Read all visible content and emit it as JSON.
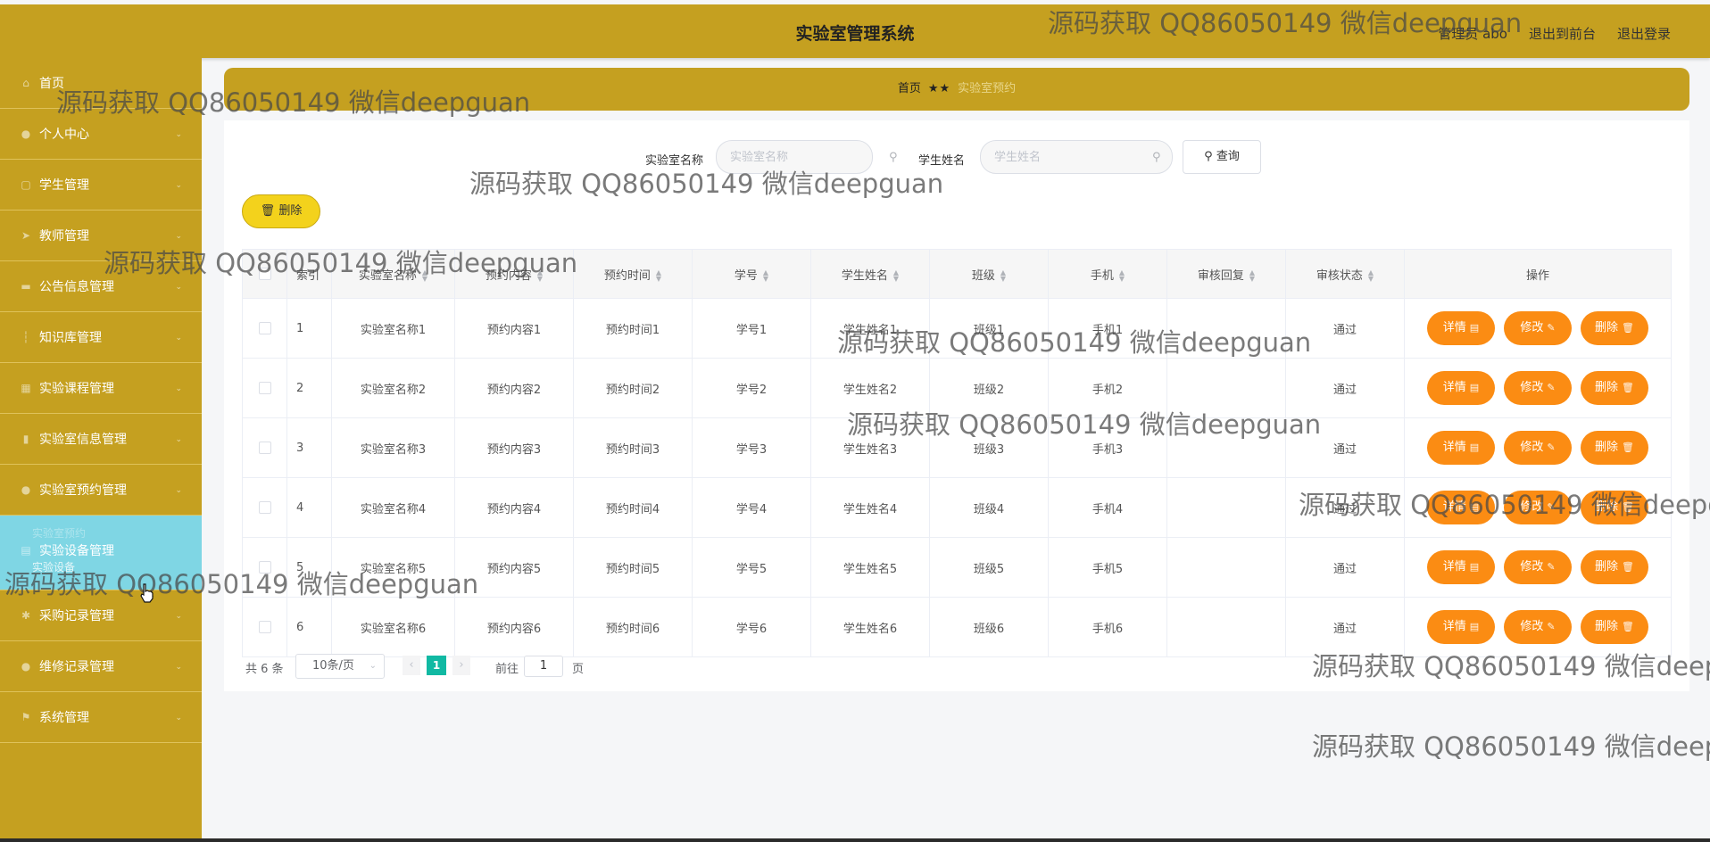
{
  "header": {
    "title": "实验室管理系统",
    "user": "管理员 abo",
    "to_front": "退出到前台",
    "logout": "退出登录"
  },
  "sidebar": {
    "items": [
      {
        "label": "首页",
        "icon": "home-icon"
      },
      {
        "label": "个人中心",
        "icon": "user-icon"
      },
      {
        "label": "学生管理",
        "icon": "list-icon"
      },
      {
        "label": "教师管理",
        "icon": "send-icon"
      },
      {
        "label": "公告信息管理",
        "icon": "folder-icon"
      },
      {
        "label": "知识库管理",
        "icon": "pin-icon"
      },
      {
        "label": "实验课程管理",
        "icon": "grid-icon"
      },
      {
        "label": "实验室信息管理",
        "icon": "chart-icon"
      },
      {
        "label": "实验室预约管理",
        "icon": "user-icon"
      },
      {
        "label": "实验设备管理",
        "icon": "briefcase-icon",
        "sub_above": "实验室预约",
        "sub_below": "实验设备"
      },
      {
        "label": "采购记录管理",
        "icon": "gear-icon"
      },
      {
        "label": "维修记录管理",
        "icon": "user-icon"
      },
      {
        "label": "系统管理",
        "icon": "flag-icon"
      }
    ]
  },
  "breadcrumb": {
    "home": "首页",
    "sep": "★★",
    "current": "实验室预约"
  },
  "search": {
    "lab_label": "实验室名称",
    "lab_placeholder": "实验室名称",
    "student_label": "学生姓名",
    "student_placeholder": "学生姓名",
    "query": "查询"
  },
  "toolbar": {
    "delete": "删除"
  },
  "table": {
    "headers": [
      "索引",
      "实验室名称",
      "预约内容",
      "预约时间",
      "学号",
      "学生姓名",
      "班级",
      "手机",
      "审核回复",
      "审核状态",
      "操作"
    ],
    "rows": [
      [
        "1",
        "实验室名称1",
        "预约内容1",
        "预约时间1",
        "学号1",
        "学生姓名1",
        "班级1",
        "手机1",
        "",
        "通过"
      ],
      [
        "2",
        "实验室名称2",
        "预约内容2",
        "预约时间2",
        "学号2",
        "学生姓名2",
        "班级2",
        "手机2",
        "",
        "通过"
      ],
      [
        "3",
        "实验室名称3",
        "预约内容3",
        "预约时间3",
        "学号3",
        "学生姓名3",
        "班级3",
        "手机3",
        "",
        "通过"
      ],
      [
        "4",
        "实验室名称4",
        "预约内容4",
        "预约时间4",
        "学号4",
        "学生姓名4",
        "班级4",
        "手机4",
        "",
        "通过"
      ],
      [
        "5",
        "实验室名称5",
        "预约内容5",
        "预约时间5",
        "学号5",
        "学生姓名5",
        "班级5",
        "手机5",
        "",
        "通过"
      ],
      [
        "6",
        "实验室名称6",
        "预约内容6",
        "预约时间6",
        "学号6",
        "学生姓名6",
        "班级6",
        "手机6",
        "",
        "通过"
      ]
    ],
    "actions": [
      "详情",
      "修改",
      "删除"
    ]
  },
  "pagination": {
    "total": "共 6 条",
    "page_size": "10条/页",
    "current_page": "1",
    "goto": "前往",
    "goto_value": "1",
    "unit": "页"
  },
  "watermark": {
    "text": "源码获取 QQ86050149 微信deepguan"
  },
  "colors": {
    "brand": "#c5a020",
    "active_menu": "#7fd6e4",
    "action_button": "#fb8c13",
    "delete_button": "#f3d21c",
    "current_page": "#11b9a3"
  }
}
